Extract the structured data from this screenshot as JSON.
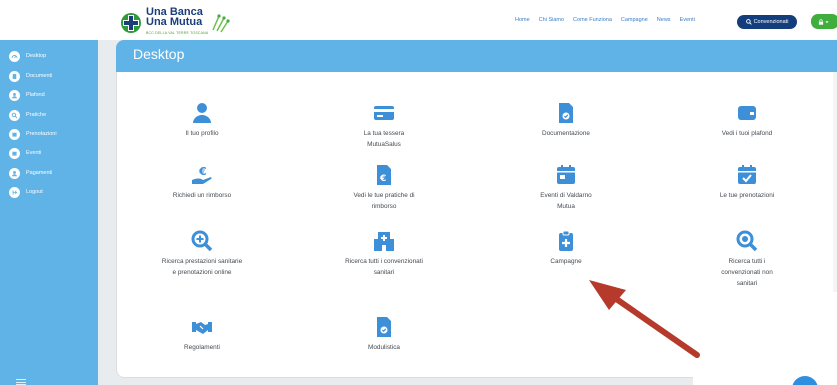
{
  "logo": {
    "line1": "Una Banca",
    "line2": "Una Mutua",
    "tagline": "BCC DELLA VAL TERRE TOSCANA"
  },
  "nav": [
    "Home",
    "Chi Siamo",
    "Come Funziona",
    "Campagne",
    "News",
    "Eventi"
  ],
  "header_button": "Convenzionati",
  "sidebar": [
    {
      "label": "Desktop",
      "icon": "gauge-icon"
    },
    {
      "label": "Documenti",
      "icon": "document-icon"
    },
    {
      "label": "Plafond",
      "icon": "user-icon"
    },
    {
      "label": "Pratiche",
      "icon": "search-icon"
    },
    {
      "label": "Prenotazioni",
      "icon": "calendar-icon"
    },
    {
      "label": "Eventi",
      "icon": "calendar-icon"
    },
    {
      "label": "Pagamenti",
      "icon": "user-icon"
    },
    {
      "label": "Logout",
      "icon": "logout-icon"
    }
  ],
  "page_title": "Desktop",
  "tiles": [
    {
      "label": "Il tuo profilo",
      "icon": "user-icon"
    },
    {
      "label": "La tua tessera MutuaSalus",
      "icon": "card-icon"
    },
    {
      "label": "Documentazione",
      "icon": "document-check-icon"
    },
    {
      "label": "Vedi i tuoi plafond",
      "icon": "wallet-icon"
    },
    {
      "label": "Richiedi un rimborso",
      "icon": "euro-hand-icon"
    },
    {
      "label": "Vedi le tue pratiche di rimborso",
      "icon": "euro-document-icon"
    },
    {
      "label": "Eventi di Valdarno Mutua",
      "icon": "calendar-icon"
    },
    {
      "label": "Le tue prenotazioni",
      "icon": "calendar-check-icon"
    },
    {
      "label": "Ricerca prestazioni sanitarie e prenotazioni online",
      "icon": "search-plus-icon"
    },
    {
      "label": "Ricerca tutti i convenzionati sanitari",
      "icon": "hospital-icon"
    },
    {
      "label": "Campagne",
      "icon": "clipboard-plus-icon"
    },
    {
      "label": "Ricerca tutti i convenzionati non sanitari",
      "icon": "search-badge-icon"
    },
    {
      "label": "Regolamenti",
      "icon": "handshake-icon"
    },
    {
      "label": "Modulistica",
      "icon": "document-check-icon"
    }
  ],
  "colors": {
    "primary": "#5fb3e6",
    "icon": "#3d8fd8",
    "header_button": "#143d7c",
    "user_button": "#3fae3d",
    "arrow": "#c0392b"
  }
}
